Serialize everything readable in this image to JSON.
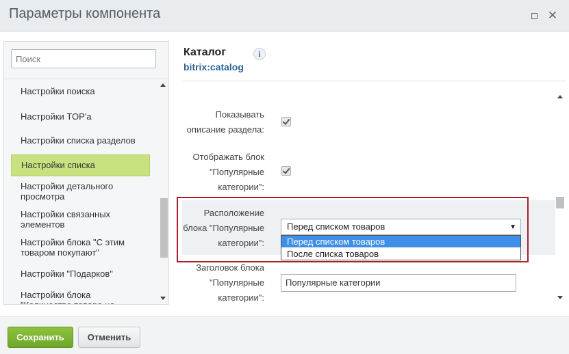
{
  "window": {
    "title": "Параметры компонента"
  },
  "sidebar": {
    "search_placeholder": "Поиск",
    "items": [
      {
        "label": "Настройки поиска"
      },
      {
        "label": "Настройки TOP'а"
      },
      {
        "label": "Настройки списка разделов"
      },
      {
        "label": "Настройки списка"
      },
      {
        "label": "Настройки детального просмотра"
      },
      {
        "label": "Настройки связанных элементов"
      },
      {
        "label": "Настройки блока \"С этим товаром покупают\""
      },
      {
        "label": "Настройки \"Подарков\""
      },
      {
        "label": "Настройки блока \"Количество товара на складе\""
      }
    ],
    "active_index": 3
  },
  "component": {
    "name": "Каталог",
    "code": "bitrix:catalog",
    "info_icon_text": "i"
  },
  "properties": {
    "show_section_description": {
      "label": "Показывать описание раздела:",
      "checked": true
    },
    "show_popular_block": {
      "label": "Отображать блок \"Популярные категории\":",
      "checked": true
    },
    "popular_block_position": {
      "label": "Расположение блока \"Популярные категории\":",
      "value": "Перед списком товаров",
      "options": [
        "Перед списком товаров",
        "После списка товаров"
      ],
      "highlighted_option": 0
    },
    "popular_block_title": {
      "label": "Заголовок блока \"Популярные категории\":",
      "value": "Популярные категории"
    }
  },
  "footer": {
    "save_label": "Сохранить",
    "cancel_label": "Отменить"
  },
  "colors": {
    "active_item": "#c9e280",
    "save_button": "#7ab231",
    "highlight_frame": "#a4232b",
    "selected_option": "#3d8fe8",
    "component_code": "#2a6496"
  },
  "icons": {
    "maximize": "maximize-icon",
    "close": "close-icon",
    "info": "info-icon",
    "dropdown": "chevron-down-icon"
  }
}
